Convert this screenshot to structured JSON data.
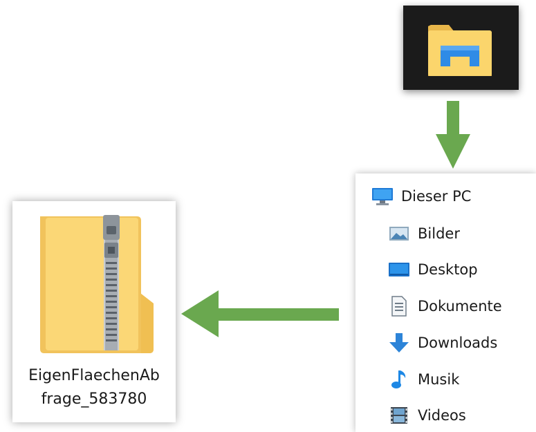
{
  "explorer_tile": {
    "icon": "file-explorer-icon",
    "background": "#1b1b1b"
  },
  "arrow_color": "#6aa84f",
  "navigation_pane": {
    "items": [
      {
        "label": "Dieser PC",
        "icon": "this-pc-icon"
      },
      {
        "label": "Bilder",
        "icon": "pictures-icon"
      },
      {
        "label": "Desktop",
        "icon": "desktop-icon"
      },
      {
        "label": "Dokumente",
        "icon": "documents-icon"
      },
      {
        "label": "Downloads",
        "icon": "downloads-icon"
      },
      {
        "label": "Musik",
        "icon": "music-icon"
      },
      {
        "label": "Videos",
        "icon": "videos-icon"
      }
    ]
  },
  "zip_file": {
    "icon": "zip-folder-icon",
    "name_line1": "EigenFlaechenAb",
    "name_line2": "frage_583780"
  }
}
